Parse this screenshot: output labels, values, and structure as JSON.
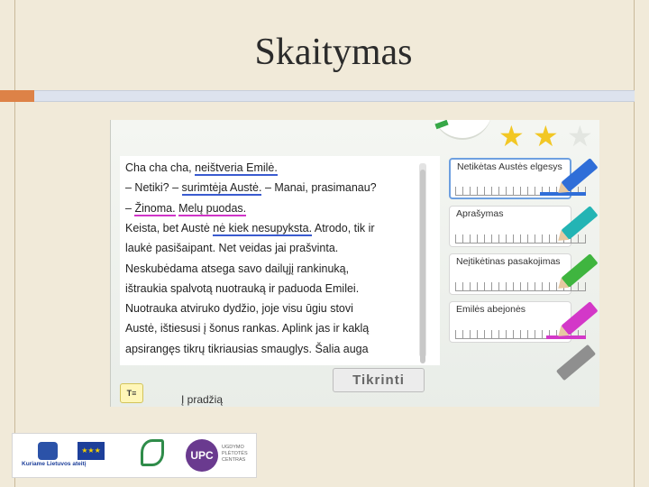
{
  "slide": {
    "title": "Skaitymas"
  },
  "reader": {
    "lines": [
      {
        "segments": [
          {
            "text": "Cha cha cha, ",
            "u": ""
          },
          {
            "text": "neištveria Emilė.",
            "u": "blue"
          }
        ]
      },
      {
        "segments": [
          {
            "text": "– Netiki? – ",
            "u": ""
          },
          {
            "text": "surimtėja Austė.",
            "u": "blue"
          },
          {
            "text": " – Manai, prasimanau?",
            "u": ""
          }
        ]
      },
      {
        "segments": [
          {
            "text": "– ",
            "u": ""
          },
          {
            "text": "Žinoma.",
            "u": "pink"
          },
          {
            "text": " ",
            "u": ""
          },
          {
            "text": "Melų puodas.",
            "u": "pink"
          }
        ]
      },
      {
        "segments": [
          {
            "text": "Keista, bet Austė ",
            "u": ""
          },
          {
            "text": "nė kiek nesupyksta.",
            "u": "blue"
          },
          {
            "text": " Atrodo, tik ir",
            "u": ""
          }
        ]
      },
      {
        "segments": [
          {
            "text": "laukė pasišaipant. Net veidas jai prašvinta.",
            "u": ""
          }
        ]
      },
      {
        "segments": [
          {
            "text": "Neskubėdama atsega savo dailųjį rankinuką,",
            "u": ""
          }
        ]
      },
      {
        "segments": [
          {
            "text": "ištraukia spalvotą nuotrauką ir paduoda Emilei.",
            "u": ""
          }
        ]
      },
      {
        "segments": [
          {
            "text": "Nuotrauka atviruko dydžio, joje visu ūgiu stovi",
            "u": ""
          }
        ]
      },
      {
        "segments": [
          {
            "text": "Austė, ištiesusi į šonus rankas. Aplink jas ir kaklą",
            "u": ""
          }
        ]
      },
      {
        "segments": [
          {
            "text": "apsirangęs tikrų tikriausias smauglys. Šalia auga",
            "u": ""
          }
        ]
      }
    ]
  },
  "tasks": [
    {
      "label": "Netikėtas Austės elgesys",
      "color": "#2f6ed8",
      "active": true,
      "fill": 0.35
    },
    {
      "label": "Aprašymas",
      "color": "#23b4b4",
      "active": false,
      "fill": 0
    },
    {
      "label": "Neįtikėtinas pasakojimas",
      "color": "#3fb53f",
      "active": false,
      "fill": 0
    },
    {
      "label": "Emilės abejonės",
      "color": "#d338c8",
      "active": false,
      "fill": 0.3
    }
  ],
  "stars": {
    "earned": 2,
    "total": 3
  },
  "buttons": {
    "check": "Tikrinti",
    "home": "Į pradžią",
    "notes": "T≡"
  },
  "logos": {
    "eu_text": "Kuriame Lietuvos ateitį",
    "upc": "UPC",
    "upc_text": "UGDYMO PLĖTOTĖS CENTRAS"
  },
  "colors": {
    "underline_blue": "#3a5bd0",
    "underline_pink": "#d035c8",
    "accent_orange": "#dd8247"
  }
}
